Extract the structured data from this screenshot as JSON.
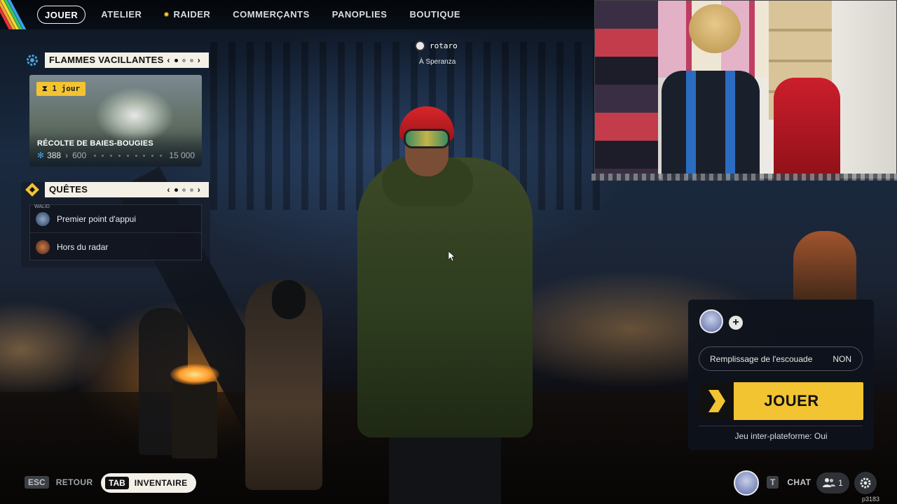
{
  "nav": {
    "items": [
      {
        "label": "JOUER",
        "active": true
      },
      {
        "label": "ATELIER"
      },
      {
        "label": "RAIDER",
        "dot": true
      },
      {
        "label": "COMMERÇANTS"
      },
      {
        "label": "PANOPLIES"
      },
      {
        "label": "BOUTIQUE"
      }
    ]
  },
  "event": {
    "title": "FLAMMES VACILLANTES",
    "badge": "1 jour",
    "name": "RÉCOLTE DE BAIES-BOUGIES",
    "current": "388",
    "next": "600",
    "max": "15 000",
    "page_index": 1,
    "page_count": 3
  },
  "quests": {
    "title": "QUÊTES",
    "player_tag": "WALID",
    "items": [
      {
        "label": "Premier point d'appui"
      },
      {
        "label": "Hors du radar"
      }
    ],
    "page_index": 1,
    "page_count": 3
  },
  "player": {
    "name": "rotaro",
    "location": "À Speranza"
  },
  "play": {
    "squad_fill_label": "Remplissage de l'escouade",
    "squad_fill_value": "NON",
    "play_label": "JOUER",
    "crossplay": "Jeu inter-plateforme: Oui",
    "add_symbol": "+"
  },
  "bottom": {
    "back_key": "ESC",
    "back_label": "RETOUR",
    "inventory_key": "TAB",
    "inventory_label": "INVENTAIRE",
    "chat_key": "T",
    "chat_label": "CHAT",
    "friends_count": "1",
    "build": "p3183"
  },
  "colors": {
    "accent_yellow": "#f2c431",
    "header_bg": "#f4f0e6",
    "panel_bg": "#0e121c"
  },
  "icons": [
    "gear-icon",
    "hourglass-icon",
    "quest-diamond-icon",
    "chevron-left-icon",
    "chevron-right-icon",
    "plus-icon",
    "friends-icon",
    "play-chevron-icon"
  ]
}
